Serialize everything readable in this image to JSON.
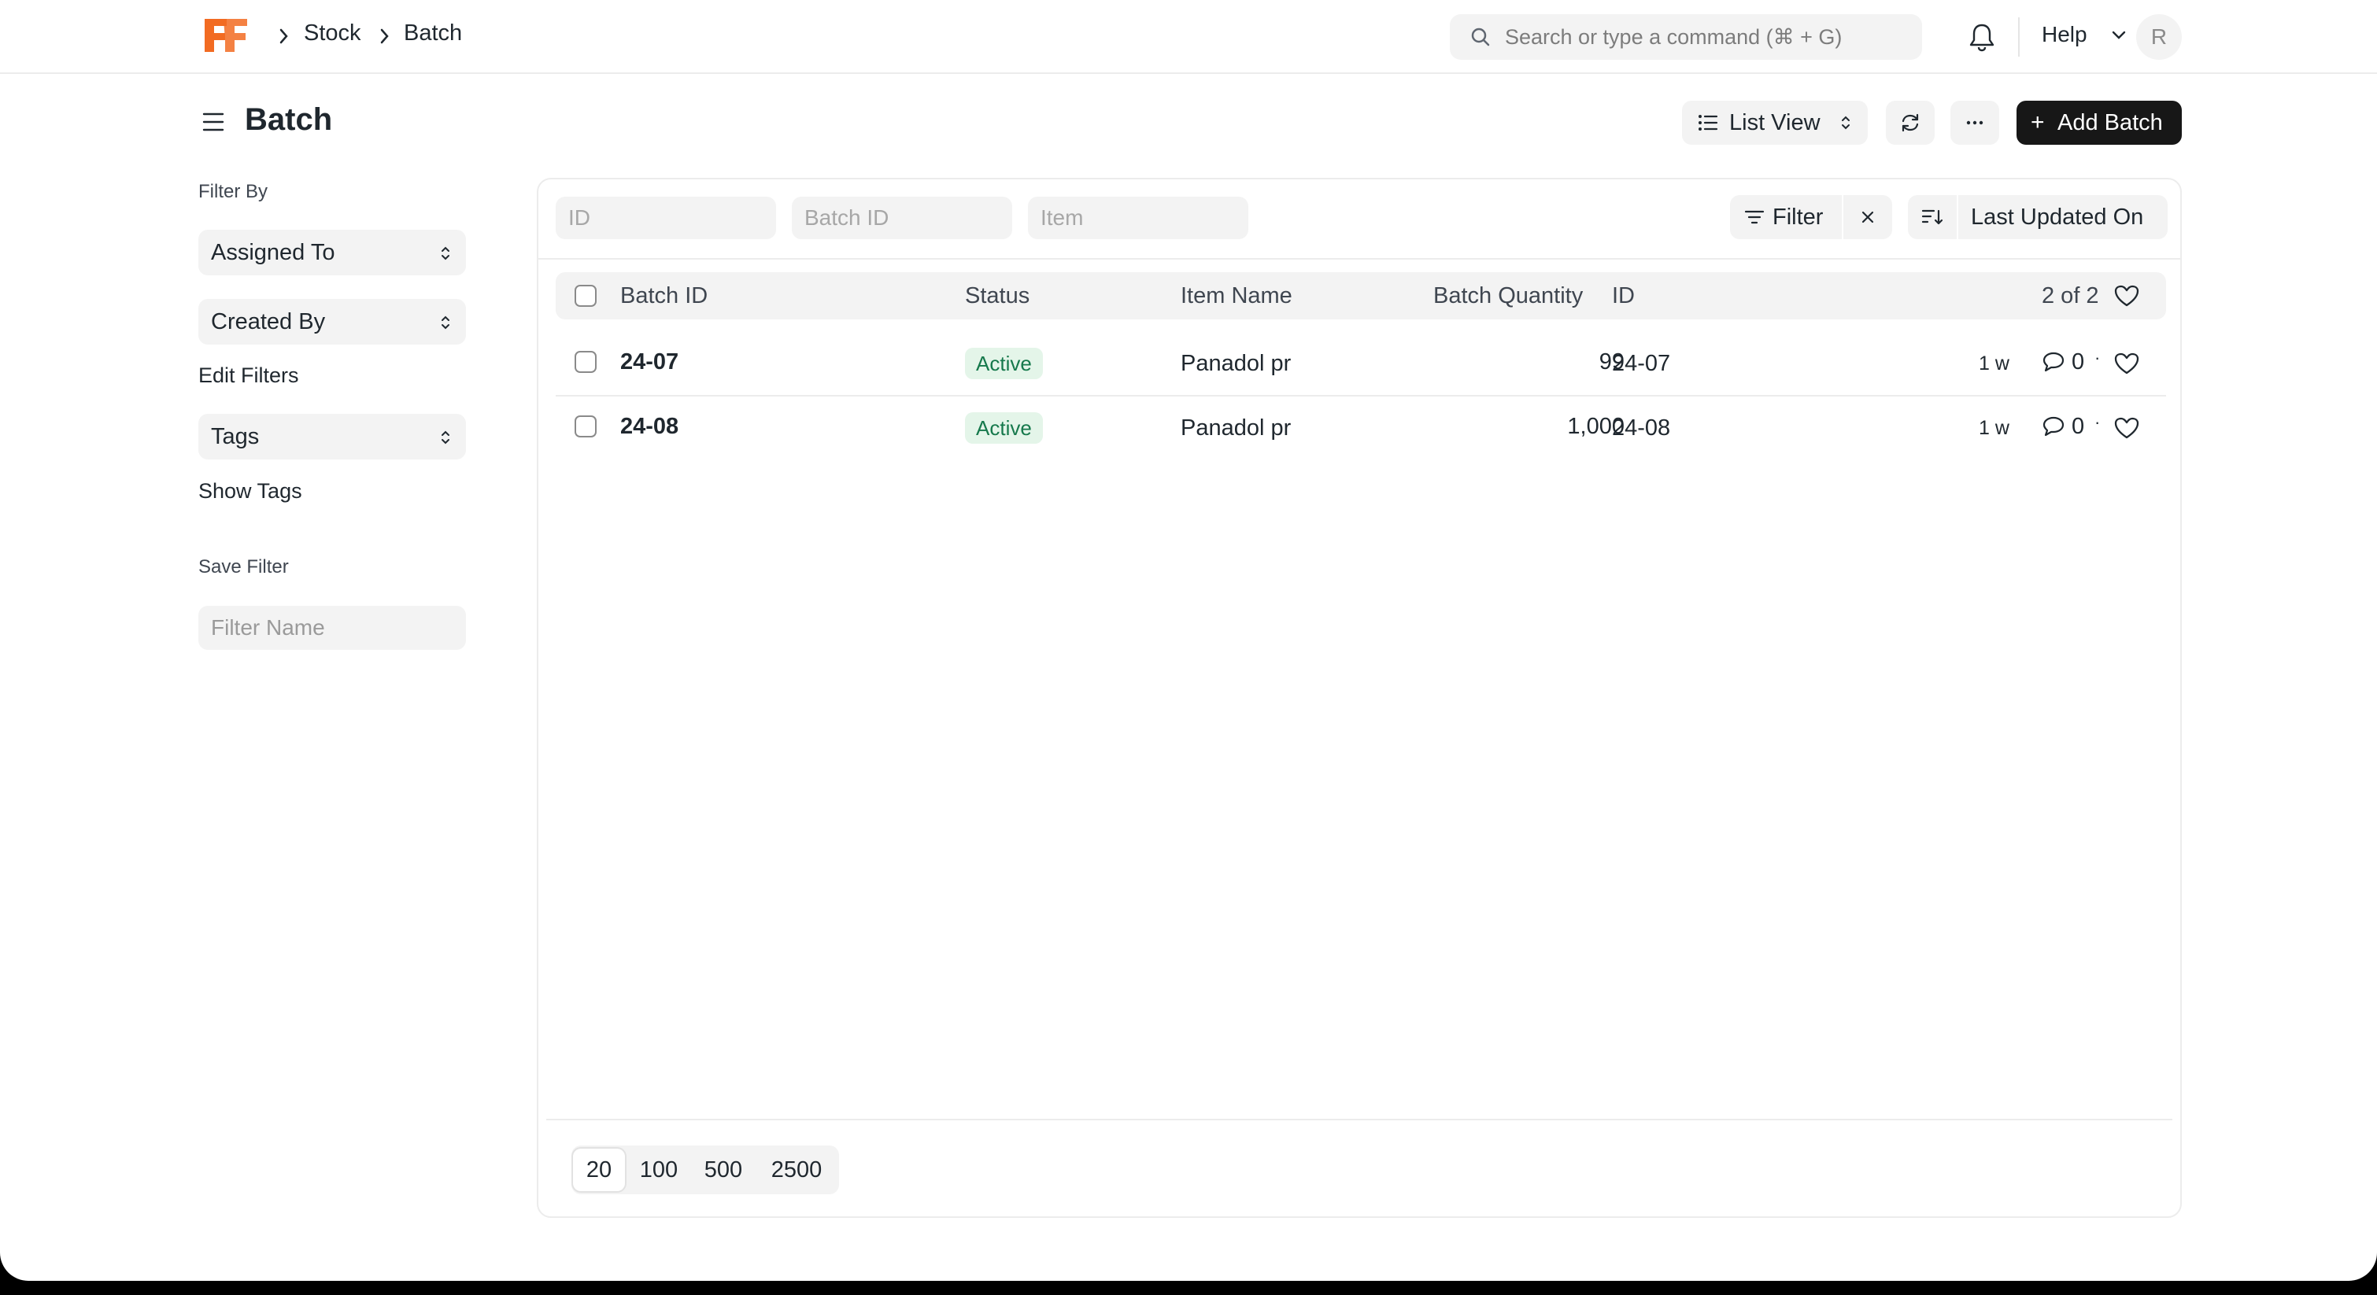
{
  "navbar": {
    "breadcrumbs": [
      "Stock",
      "Batch"
    ],
    "search_placeholder": "Search or type a command (⌘ + G)",
    "help_label": "Help",
    "avatar_initial": "R"
  },
  "header": {
    "title": "Batch",
    "view_label": "List View",
    "add_label": "Add Batch"
  },
  "sidebar": {
    "filter_by_label": "Filter By",
    "assigned_to": "Assigned To",
    "created_by": "Created By",
    "edit_filters": "Edit Filters",
    "tags": "Tags",
    "show_tags": "Show Tags",
    "save_filter_label": "Save Filter",
    "filter_name_placeholder": "Filter Name"
  },
  "filters": {
    "id_placeholder": "ID",
    "batch_id_placeholder": "Batch ID",
    "item_placeholder": "Item",
    "filter_label": "Filter",
    "sort_label": "Last Updated On"
  },
  "list": {
    "columns": {
      "batch_id": "Batch ID",
      "status": "Status",
      "item_name": "Item Name",
      "batch_quantity": "Batch Quantity",
      "id": "ID"
    },
    "count": "2 of 2",
    "rows": [
      {
        "batch_id": "24-07",
        "status": "Active",
        "item_name": "Panadol pr",
        "batch_quantity": "99",
        "id": "24-07",
        "modified": "1 w",
        "comments": "0"
      },
      {
        "batch_id": "24-08",
        "status": "Active",
        "item_name": "Panadol pr",
        "batch_quantity": "1,000",
        "id": "24-08",
        "modified": "1 w",
        "comments": "0"
      }
    ]
  },
  "paging": {
    "page_sizes": [
      "20",
      "100",
      "500",
      "2500"
    ],
    "selected": "20"
  },
  "colors": {
    "brand": "#f26b22",
    "primary_button": "#171717",
    "status_active_bg": "#e4f5e9",
    "status_active_text": "#16794c"
  },
  "icons": [
    "frappe-logo-icon",
    "chevron-right-icon",
    "search-icon",
    "bell-icon",
    "chevron-down-icon",
    "hamburger-icon",
    "list-icon",
    "updown-caret-icon",
    "refresh-icon",
    "more-icon",
    "plus-icon",
    "filter-icon",
    "close-icon",
    "sort-icon",
    "heart-icon",
    "comment-icon"
  ]
}
